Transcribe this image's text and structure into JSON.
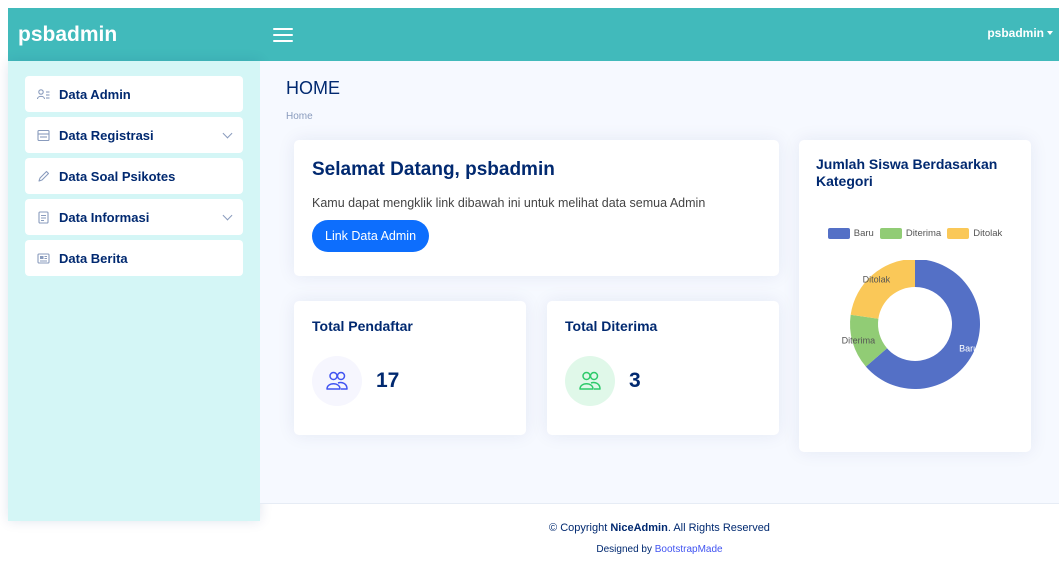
{
  "header": {
    "brand": "psbadmin",
    "user": "psbadmin"
  },
  "sidebar": {
    "items": [
      {
        "label": "Data Admin",
        "icon": "admin-users-icon",
        "has_submenu": false
      },
      {
        "label": "Data Registrasi",
        "icon": "registration-icon",
        "has_submenu": true
      },
      {
        "label": "Data Soal Psikotes",
        "icon": "pencil-icon",
        "has_submenu": false
      },
      {
        "label": "Data Informasi",
        "icon": "document-icon",
        "has_submenu": true
      },
      {
        "label": "Data Berita",
        "icon": "newspaper-icon",
        "has_submenu": false
      }
    ]
  },
  "page": {
    "title": "HOME",
    "breadcrumb": "Home"
  },
  "welcome": {
    "title": "Selamat Datang, psbadmin",
    "text": "Kamu dapat mengklik link dibawah ini untuk melihat data semua Admin",
    "button": "Link Data Admin"
  },
  "stats": [
    {
      "title": "Total Pendaftar",
      "value": "17",
      "icon": "people-icon"
    },
    {
      "title": "Total Diterima",
      "value": "3",
      "icon": "people-icon"
    }
  ],
  "chart_card": {
    "title": "Jumlah Siswa Berdasarkan Kategori"
  },
  "chart_data": {
    "type": "pie",
    "title": "Jumlah Siswa Berdasarkan Kategori",
    "legend_position": "top",
    "categories": [
      "Baru",
      "Diterima",
      "Ditolak"
    ],
    "values": [
      14,
      3,
      5
    ],
    "colors": [
      "#5470c6",
      "#91cc75",
      "#fac858"
    ]
  },
  "footer": {
    "copyright_prefix": "© Copyright",
    "copyright_brand": "NiceAdmin",
    "copyright_suffix": ". All Rights Reserved",
    "designed_prefix": "Designed by",
    "designed_link": "BootstrapMade"
  },
  "colors": {
    "topbar": "#41babb",
    "sidebar": "#d4f6f6",
    "primary_text": "#012970",
    "button": "#0d6efd"
  }
}
